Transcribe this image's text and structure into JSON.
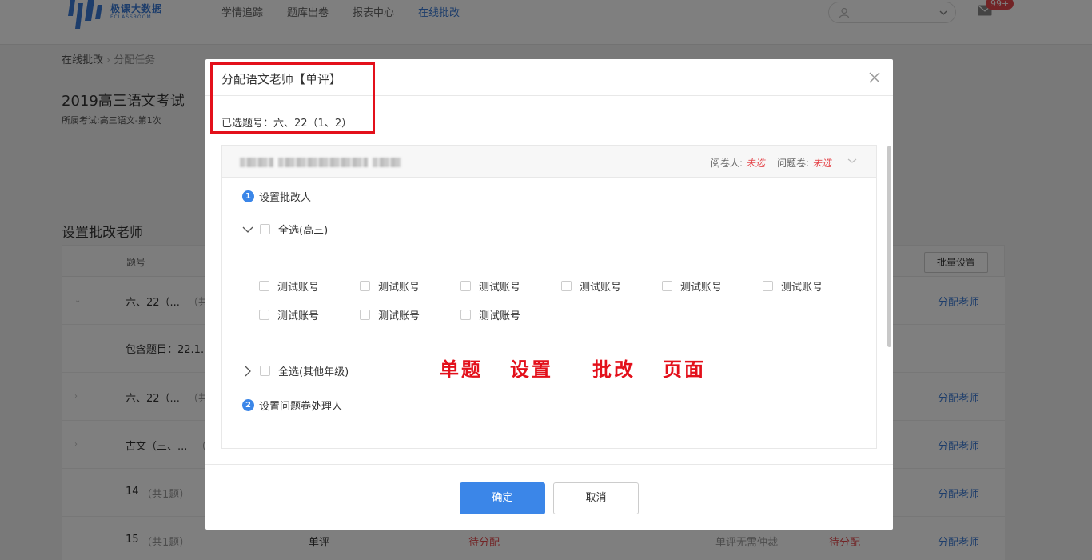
{
  "brand": {
    "name": "极课大数据",
    "sub": "FCLASSROOM",
    "accent": "#3b7bd6"
  },
  "nav": {
    "items": [
      {
        "label": "学情追踪"
      },
      {
        "label": "题库出卷"
      },
      {
        "label": "报表中心"
      },
      {
        "label": "在线批改"
      }
    ],
    "active_index": 3,
    "mail_badge": "99+"
  },
  "breadcrumb": {
    "root": "在线批改",
    "current": "分配任务"
  },
  "exam": {
    "title": "2019高三语文考试",
    "subtitle": "所属考试:高三语文-第1次"
  },
  "section": {
    "title": "设置批改老师"
  },
  "table": {
    "col_question": "题号",
    "batch_label": "批量设置",
    "rows": [
      {
        "question": "六、22（...",
        "suffix": "（共",
        "action": "分配老师"
      },
      {
        "question": "六、22（...",
        "suffix": "（共",
        "action": "分配老师"
      },
      {
        "question": "古文（三、...",
        "suffix": "（",
        "action": "分配老师"
      },
      {
        "question": "14",
        "suffix": "（共1题）",
        "action": "分配老师"
      },
      {
        "question": "15",
        "suffix": "（共1题）",
        "mode": "单评",
        "status": "待分配",
        "note": "单评无需仲裁",
        "status2": "待分配",
        "action": "分配老师"
      }
    ],
    "sub_label": "包含题目：22.1."
  },
  "modal": {
    "title": "分配语文老师【单评】",
    "selected_label": "已选题号：六、22（1、2）",
    "status_reader_label": "阅卷人:",
    "status_reader_value": "未选",
    "status_problem_label": "问题卷:",
    "status_problem_value": "未选",
    "step1": {
      "num": "1",
      "label": "设置批改人"
    },
    "group1": {
      "label": "全选(高三)"
    },
    "accounts": [
      "测试账号",
      "测试账号",
      "测试账号",
      "测试账号",
      "测试账号",
      "测试账号",
      "测试账号",
      "测试账号",
      "测试账号"
    ],
    "group2": {
      "label": "全选(其他年级)"
    },
    "step2": {
      "num": "2",
      "label": "设置问题卷处理人"
    },
    "annotation": [
      "单题",
      "设置",
      "批改",
      "页面"
    ],
    "ok_label": "确定",
    "cancel_label": "取消"
  },
  "colors": {
    "primary": "#3b86e8",
    "danger": "#e5484d",
    "annotation": "#e3101b"
  }
}
